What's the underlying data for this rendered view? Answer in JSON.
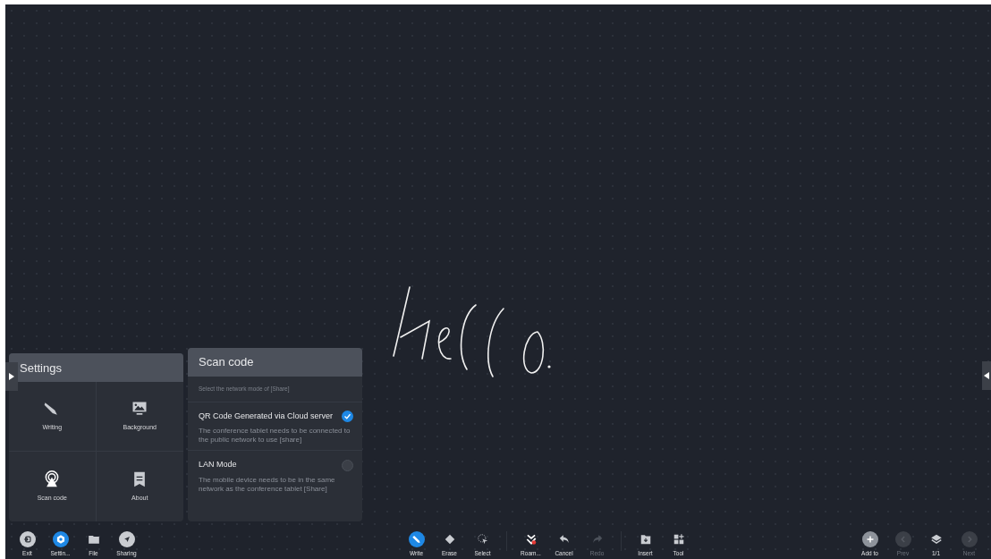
{
  "settings_panel": {
    "title": "Settings",
    "tiles": [
      {
        "kind": "pen",
        "label": "Writing"
      },
      {
        "kind": "monitor",
        "label": "Background"
      },
      {
        "kind": "beacon",
        "label": "Scan code"
      },
      {
        "kind": "book",
        "label": "About"
      }
    ]
  },
  "scan_panel": {
    "title": "Scan code",
    "subtitle": "Select the network mode of [Share]",
    "options": [
      {
        "title": "QR Code Generated via Cloud server",
        "description": "The conference tablet needs to be connected to the public network to use [share]",
        "selected": true
      },
      {
        "title": "LAN Mode",
        "description": "The mobile device needs to be in the same network as the conference tablet [Share]",
        "selected": false
      }
    ]
  },
  "toolbar": {
    "left": [
      {
        "kind": "exit",
        "label": "Exit",
        "selected": false,
        "disabled": false
      },
      {
        "kind": "gear",
        "label": "Settin...",
        "selected": true,
        "disabled": false
      },
      {
        "kind": "folder",
        "label": "File",
        "selected": false,
        "disabled": false
      },
      {
        "kind": "send",
        "label": "Sharing",
        "selected": false,
        "disabled": false
      }
    ],
    "center": [
      [
        {
          "kind": "pen",
          "label": "Write",
          "selected": true,
          "disabled": false
        },
        {
          "kind": "eraser",
          "label": "Erase",
          "selected": false,
          "disabled": false
        },
        {
          "kind": "lasso",
          "label": "Select",
          "selected": false,
          "disabled": false
        }
      ],
      [
        {
          "kind": "roam",
          "label": "Roam...",
          "selected": false,
          "disabled": false
        },
        {
          "kind": "undo",
          "label": "Cancel",
          "selected": false,
          "disabled": false
        },
        {
          "kind": "redo",
          "label": "Redo",
          "selected": false,
          "disabled": true
        }
      ],
      [
        {
          "kind": "insert",
          "label": "Insert",
          "selected": false,
          "disabled": false
        },
        {
          "kind": "grid",
          "label": "Tool",
          "selected": false,
          "disabled": false
        }
      ]
    ],
    "right": [
      {
        "kind": "plus",
        "label": "Add to",
        "selected": false,
        "disabled": false
      },
      {
        "kind": "prev",
        "label": "Prev",
        "selected": false,
        "disabled": true
      },
      {
        "kind": "layers",
        "label": "1/1",
        "selected": false,
        "disabled": false
      },
      {
        "kind": "next",
        "label": "Next",
        "selected": false,
        "disabled": true
      }
    ]
  }
}
